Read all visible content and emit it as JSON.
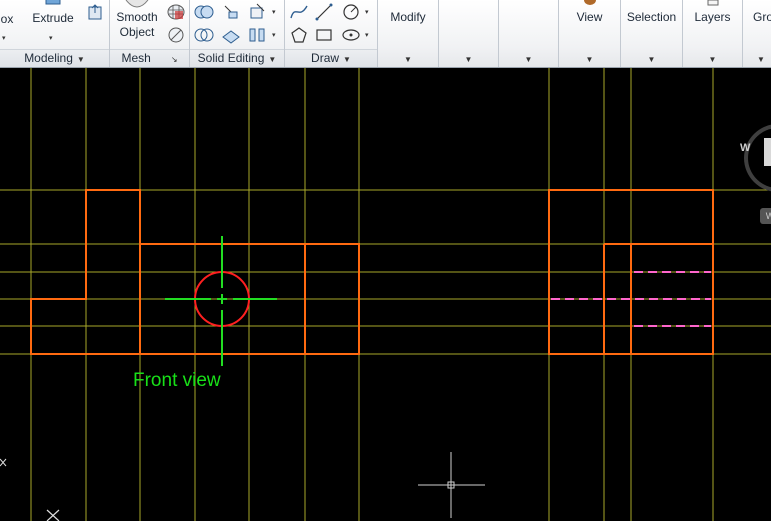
{
  "ribbon": {
    "modeling": {
      "title": "Modeling",
      "box_label": "ox",
      "extrude_label": "Extrude"
    },
    "mesh": {
      "title": "Mesh",
      "smooth_label_1": "Smooth",
      "smooth_label_2": "Object"
    },
    "solid_editing": {
      "title": "Solid Editing"
    },
    "draw": {
      "title": "Draw"
    },
    "modify": {
      "title": "Modify"
    },
    "view": {
      "title": "View"
    },
    "selection": {
      "title": "Selection"
    },
    "layers": {
      "title": "Layers"
    },
    "groups": {
      "title": "Gro"
    }
  },
  "canvas": {
    "caption": "Front view",
    "viewcube_compass": "W",
    "wcs_label": "W"
  },
  "colors": {
    "construction_lines": "#a8a82a",
    "object_lines": "#ff6a10",
    "hidden_lines": "#ff66cc",
    "circle": "#ff2020",
    "center_lines": "#22dd22",
    "caption": "#18e018",
    "background": "#000000"
  }
}
